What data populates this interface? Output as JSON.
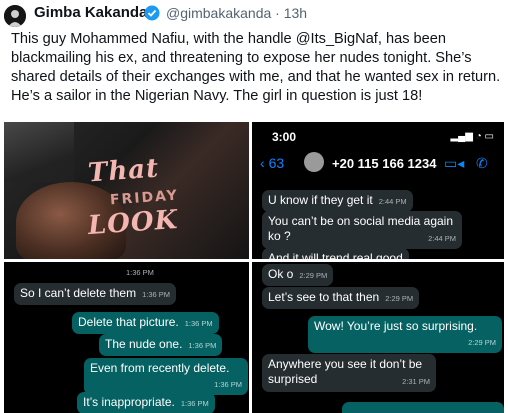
{
  "author": {
    "name": "Gimba Kakanda",
    "handle": "@gimbakakanda",
    "time": "· 13h"
  },
  "tweet_text": "This guy Mohammed Nafiu, with the handle @Its_BigNaf, has been blackmailing his ex, and threatening to expose her nudes tonight. She’s shared details of their exchanges with me, and that he wanted sex in return. He’s a sailor in the Nigerian Navy. The girl in question is just 18!",
  "image1": {
    "line1": "That",
    "line2": "FRIDAY",
    "line3": "LOOK"
  },
  "image2": {
    "time": "3:00",
    "back_count": "63",
    "contact": "+20 115 166 1234",
    "messages": [
      {
        "text": "U know if they get it",
        "time": "2:44 PM"
      },
      {
        "text": "You can’t be on social media again",
        "text2": "ko ?",
        "time": "2:44 PM"
      },
      {
        "text": "And it will trend real good",
        "time": ""
      }
    ]
  },
  "image3": {
    "top_time": "1:36 PM",
    "messages": [
      {
        "text": "So I can’t delete them",
        "time": "1:36 PM",
        "dir": "in"
      },
      {
        "text": "Delete that picture.",
        "time": "1:36 PM",
        "dir": "out"
      },
      {
        "text": "The nude one.",
        "time": "1:36 PM",
        "dir": "out"
      },
      {
        "text": "Even from recently delete.",
        "time": "1:36 PM",
        "dir": "out"
      },
      {
        "text": "It’s inappropriate.",
        "time": "1:36 PM",
        "dir": "out"
      }
    ]
  },
  "image4": {
    "messages": [
      {
        "text": "Ok o",
        "time": "2:29 PM",
        "dir": "in"
      },
      {
        "text": "Let’s see to that then",
        "time": "2:29 PM",
        "dir": "in"
      },
      {
        "text": "Wow! You’re just so surprising.",
        "time": "2:29 PM",
        "dir": "out"
      },
      {
        "text": "Anywhere you see it don’t be",
        "text2": "surprised",
        "time": "2:31 PM",
        "dir": "in"
      }
    ]
  }
}
